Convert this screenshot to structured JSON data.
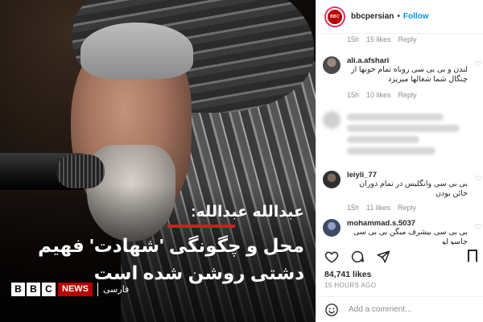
{
  "post": {
    "headline_name": "عبدالله عبدالله:",
    "headline_main": "محل و چگونگی 'شهادت' فهیم دشتی روشن شده است",
    "brand_logo_letters": [
      "B",
      "B",
      "C"
    ],
    "brand_news": "NEWS",
    "brand_language": "فارسی"
  },
  "header": {
    "avatar_text": "BBC",
    "username": "bbcpersian",
    "separator": "•",
    "follow_label": "Follow"
  },
  "comments": [
    {
      "type": "meta_only",
      "time": "15h",
      "likes": "15 likes",
      "reply": "Reply"
    },
    {
      "type": "comment",
      "user": "ali.a.afshari",
      "text": "لندن و بی بی سی روباه تمام خونها از چنگال شما شغالها میریزد",
      "time": "15h",
      "likes": "10 likes",
      "reply": "Reply",
      "avatar_color": "#4a4a4a"
    },
    {
      "type": "blurred"
    },
    {
      "type": "comment",
      "user": "leiyli_77",
      "text": "بی بی سی وانگلیس در تمام دوران خائن بودن",
      "time": "15h",
      "likes": "11 likes",
      "reply": "Reply",
      "avatar_color": "#2f2f2f"
    },
    {
      "type": "comment",
      "user": "mohammad.s.5037",
      "text": "بی بی سی بیشرف میگن بی بی سی جاسو لو",
      "avatar_color": "#3d4a66"
    }
  ],
  "heart_glyph": "♡",
  "actions": {
    "like_icon": "heart-icon",
    "comment_icon": "comment-icon",
    "share_icon": "share-icon",
    "save_icon": "bookmark-icon"
  },
  "stats": {
    "likes": "84,741 likes",
    "time_ago": "15 HOURS AGO"
  },
  "add_comment": {
    "placeholder": "Add a comment..."
  },
  "colors": {
    "follow": "#0095f6",
    "bbc_red": "#b80000",
    "headline_accent": "#d91a1a"
  }
}
